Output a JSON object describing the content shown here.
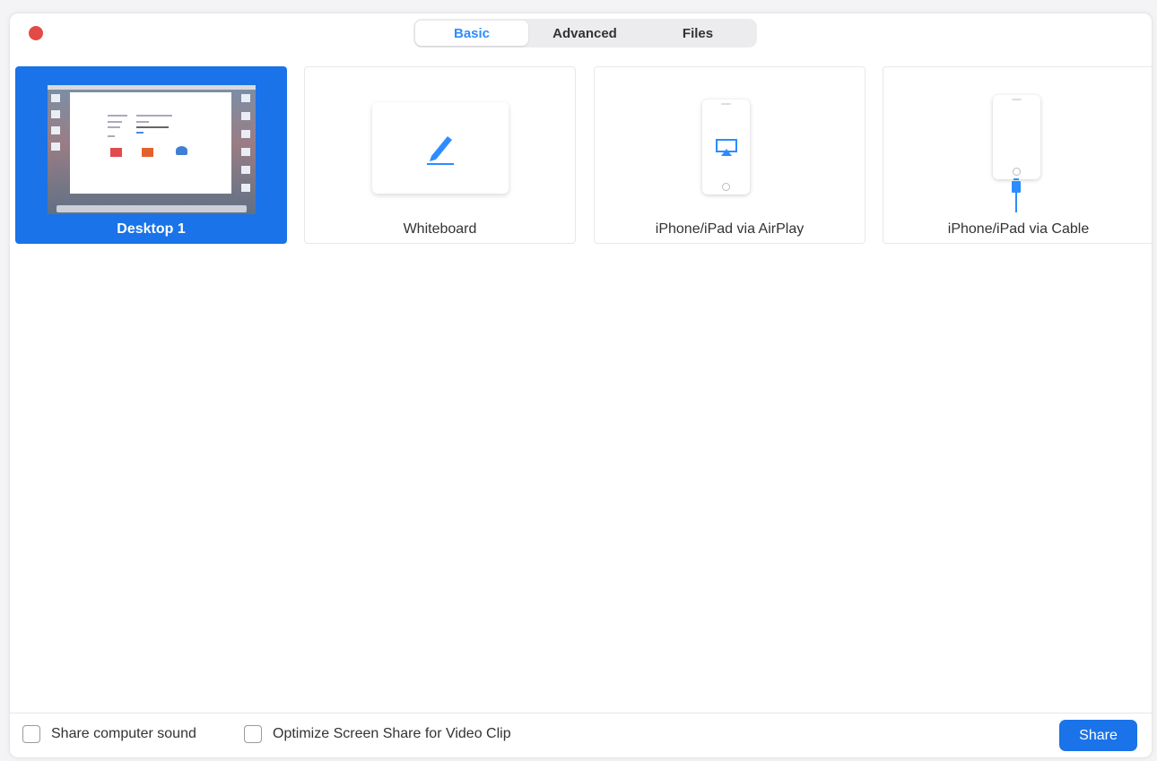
{
  "tabs": [
    "Basic",
    "Advanced",
    "Files"
  ],
  "active_tab": "Basic",
  "cards": [
    {
      "label": "Desktop 1",
      "icon": "desktop-thumbnail",
      "selected": true
    },
    {
      "label": "Whiteboard",
      "icon": "pencil-icon",
      "selected": false
    },
    {
      "label": "iPhone/iPad via AirPlay",
      "icon": "airplay-icon",
      "selected": false
    },
    {
      "label": "iPhone/iPad via Cable",
      "icon": "lightning-cable-icon",
      "selected": false
    }
  ],
  "footer": {
    "share_sound_label": "Share computer sound",
    "share_sound_checked": false,
    "optimize_label": "Optimize Screen Share for Video Clip",
    "optimize_checked": false,
    "share_button": "Share"
  },
  "colors": {
    "accent": "#1a73e8",
    "tab_active_text": "#2d8cff",
    "close_dot": "#e24b45"
  }
}
